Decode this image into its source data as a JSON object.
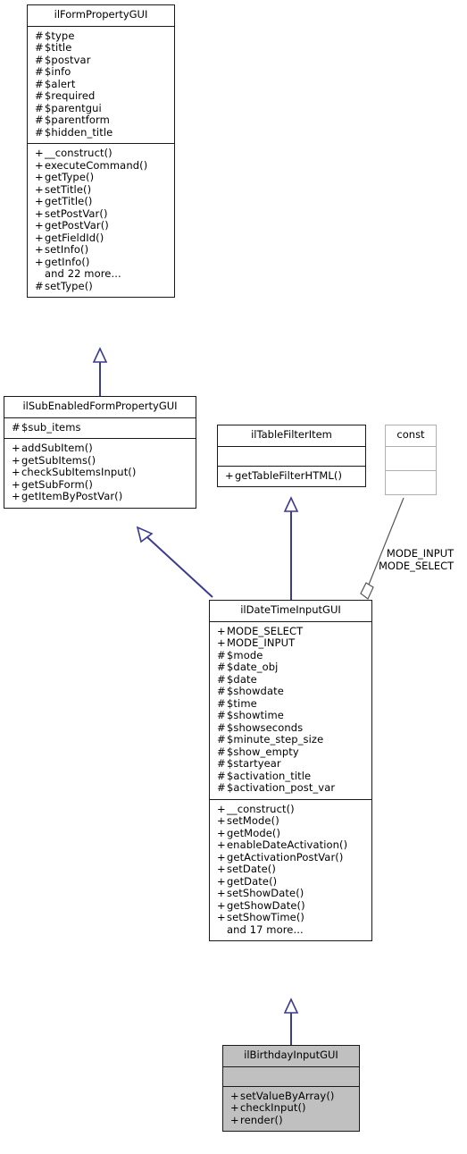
{
  "diagram": {
    "type": "uml-class-diagram",
    "title": "ilBirthdayInputGUI class inheritance diagram",
    "classes": [
      {
        "id": "ilFormPropertyGUI",
        "name": "ilFormPropertyGUI",
        "attributes": [
          {
            "visibility": "#",
            "name": "$type"
          },
          {
            "visibility": "#",
            "name": "$title"
          },
          {
            "visibility": "#",
            "name": "$postvar"
          },
          {
            "visibility": "#",
            "name": "$info"
          },
          {
            "visibility": "#",
            "name": "$alert"
          },
          {
            "visibility": "#",
            "name": "$required"
          },
          {
            "visibility": "#",
            "name": "$parentgui"
          },
          {
            "visibility": "#",
            "name": "$parentform"
          },
          {
            "visibility": "#",
            "name": "$hidden_title"
          }
        ],
        "methods": [
          {
            "visibility": "+",
            "name": "__construct()"
          },
          {
            "visibility": "+",
            "name": "executeCommand()"
          },
          {
            "visibility": "+",
            "name": "getType()"
          },
          {
            "visibility": "+",
            "name": "setTitle()"
          },
          {
            "visibility": "+",
            "name": "getTitle()"
          },
          {
            "visibility": "+",
            "name": "setPostVar()"
          },
          {
            "visibility": "+",
            "name": "getPostVar()"
          },
          {
            "visibility": "+",
            "name": "getFieldId()"
          },
          {
            "visibility": "+",
            "name": "setInfo()"
          },
          {
            "visibility": "+",
            "name": "getInfo()"
          },
          {
            "visibility": "",
            "name": "and 22 more..."
          },
          {
            "visibility": "#",
            "name": "setType()"
          }
        ]
      },
      {
        "id": "ilSubEnabledFormPropertyGUI",
        "name": "ilSubEnabledFormPropertyGUI",
        "attributes": [
          {
            "visibility": "#",
            "name": "$sub_items"
          }
        ],
        "methods": [
          {
            "visibility": "+",
            "name": "addSubItem()"
          },
          {
            "visibility": "+",
            "name": "getSubItems()"
          },
          {
            "visibility": "+",
            "name": "checkSubItemsInput()"
          },
          {
            "visibility": "+",
            "name": "getSubForm()"
          },
          {
            "visibility": "+",
            "name": "getItemByPostVar()"
          }
        ]
      },
      {
        "id": "ilTableFilterItem",
        "name": "ilTableFilterItem",
        "attributes": [],
        "methods": [
          {
            "visibility": "+",
            "name": "getTableFilterHTML()"
          }
        ]
      },
      {
        "id": "const",
        "name": "const",
        "attributes": [],
        "methods": []
      },
      {
        "id": "ilDateTimeInputGUI",
        "name": "ilDateTimeInputGUI",
        "attributes": [
          {
            "visibility": "+",
            "name": "MODE_SELECT"
          },
          {
            "visibility": "+",
            "name": "MODE_INPUT"
          },
          {
            "visibility": "#",
            "name": "$mode"
          },
          {
            "visibility": "#",
            "name": "$date_obj"
          },
          {
            "visibility": "#",
            "name": "$date"
          },
          {
            "visibility": "#",
            "name": "$showdate"
          },
          {
            "visibility": "#",
            "name": "$time"
          },
          {
            "visibility": "#",
            "name": "$showtime"
          },
          {
            "visibility": "#",
            "name": "$showseconds"
          },
          {
            "visibility": "#",
            "name": "$minute_step_size"
          },
          {
            "visibility": "#",
            "name": "$show_empty"
          },
          {
            "visibility": "#",
            "name": "$startyear"
          },
          {
            "visibility": "#",
            "name": "$activation_title"
          },
          {
            "visibility": "#",
            "name": "$activation_post_var"
          }
        ],
        "methods": [
          {
            "visibility": "+",
            "name": "__construct()"
          },
          {
            "visibility": "+",
            "name": "setMode()"
          },
          {
            "visibility": "+",
            "name": "getMode()"
          },
          {
            "visibility": "+",
            "name": "enableDateActivation()"
          },
          {
            "visibility": "+",
            "name": "getActivationPostVar()"
          },
          {
            "visibility": "+",
            "name": "setDate()"
          },
          {
            "visibility": "+",
            "name": "getDate()"
          },
          {
            "visibility": "+",
            "name": "setShowDate()"
          },
          {
            "visibility": "+",
            "name": "getShowDate()"
          },
          {
            "visibility": "+",
            "name": "setShowTime()"
          },
          {
            "visibility": "",
            "name": "and 17 more..."
          }
        ]
      },
      {
        "id": "ilBirthdayInputGUI",
        "name": "ilBirthdayInputGUI",
        "attributes": [],
        "methods": [
          {
            "visibility": "+",
            "name": "setValueByArray()"
          },
          {
            "visibility": "+",
            "name": "checkInput()"
          },
          {
            "visibility": "+",
            "name": "render()"
          }
        ]
      }
    ],
    "edges": [
      {
        "from": "ilSubEnabledFormPropertyGUI",
        "to": "ilFormPropertyGUI",
        "kind": "inheritance",
        "label": ""
      },
      {
        "from": "ilDateTimeInputGUI",
        "to": "ilSubEnabledFormPropertyGUI",
        "kind": "inheritance",
        "label": ""
      },
      {
        "from": "ilDateTimeInputGUI",
        "to": "ilTableFilterItem",
        "kind": "inheritance",
        "label": ""
      },
      {
        "from": "const",
        "to": "ilDateTimeInputGUI",
        "kind": "aggregation",
        "label": "MODE_INPUT\nMODE_SELECT"
      },
      {
        "from": "ilBirthdayInputGUI",
        "to": "ilDateTimeInputGUI",
        "kind": "inheritance",
        "label": ""
      }
    ],
    "edge_labels": {
      "const_aggregation_line1": "MODE_INPUT",
      "const_aggregation_line2": "MODE_SELECT"
    },
    "colors": {
      "box_border": "#1a1a1a",
      "box_fill": "#ffffff",
      "highlight_fill": "#c0c0c0",
      "faint_border": "#b0b0b0",
      "inheritance_edge": "#3b3b8f",
      "aggregation_edge": "#555555",
      "text": "#000000"
    }
  }
}
